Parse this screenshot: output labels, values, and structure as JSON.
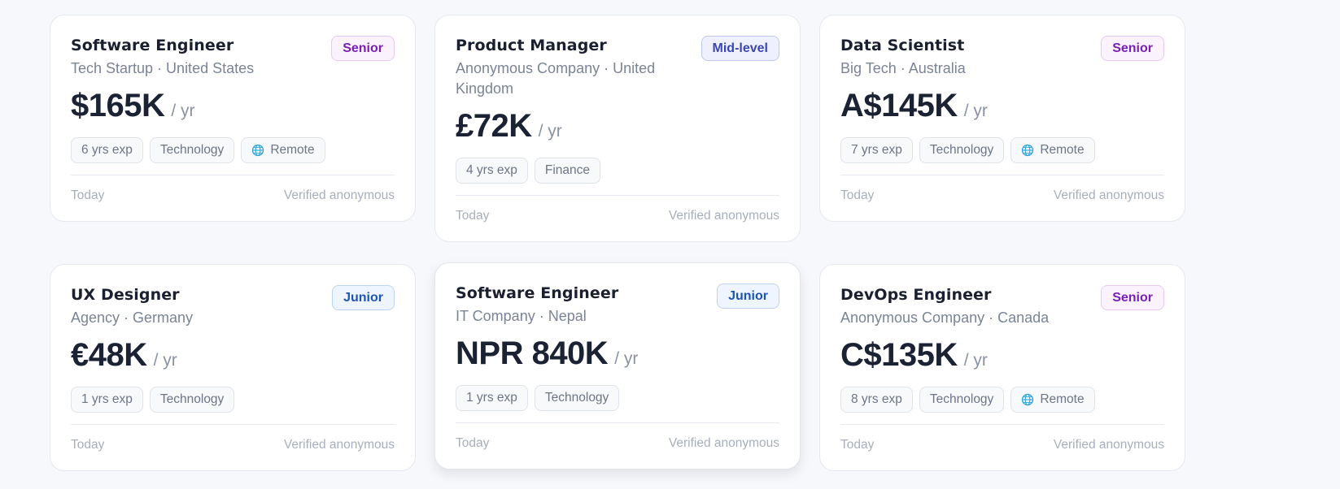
{
  "cards": [
    {
      "title": "Software Engineer",
      "subtitle": "Tech Startup · United States",
      "level": "Senior",
      "amount": "$165K",
      "period": "/ yr",
      "tags": [
        "6 yrs exp",
        "Technology",
        "Remote"
      ],
      "posted": "Today",
      "verified": "Verified anonymous"
    },
    {
      "title": "Product Manager",
      "subtitle": "Anonymous Company · United Kingdom",
      "level": "Mid-level",
      "amount": "£72K",
      "period": "/ yr",
      "tags": [
        "4 yrs exp",
        "Finance"
      ],
      "posted": "Today",
      "verified": "Verified anonymous"
    },
    {
      "title": "Data Scientist",
      "subtitle": "Big Tech · Australia",
      "level": "Senior",
      "amount": "A$145K",
      "period": "/ yr",
      "tags": [
        "7 yrs exp",
        "Technology",
        "Remote"
      ],
      "posted": "Today",
      "verified": "Verified anonymous"
    },
    {
      "title": "UX Designer",
      "subtitle": "Agency · Germany",
      "level": "Junior",
      "amount": "€48K",
      "period": "/ yr",
      "tags": [
        "1 yrs exp",
        "Technology"
      ],
      "posted": "Today",
      "verified": "Verified anonymous"
    },
    {
      "title": "Software Engineer",
      "subtitle": "IT Company · Nepal",
      "level": "Junior",
      "amount": "NPR 840K",
      "period": "/ yr",
      "tags": [
        "1 yrs exp",
        "Technology"
      ],
      "posted": "Today",
      "verified": "Verified anonymous"
    },
    {
      "title": "DevOps Engineer",
      "subtitle": "Anonymous Company · Canada",
      "level": "Senior",
      "amount": "C$135K",
      "period": "/ yr",
      "tags": [
        "8 yrs exp",
        "Technology",
        "Remote"
      ],
      "posted": "Today",
      "verified": "Verified anonymous"
    }
  ],
  "colors": {
    "background": "#f7f8fb",
    "senior_badge": "#7b1fb5",
    "mid_badge": "#3a47b0",
    "junior_badge": "#1d55b7",
    "remote_icon": "#2aa3e0"
  },
  "icons": {
    "remote": "globe-icon"
  }
}
